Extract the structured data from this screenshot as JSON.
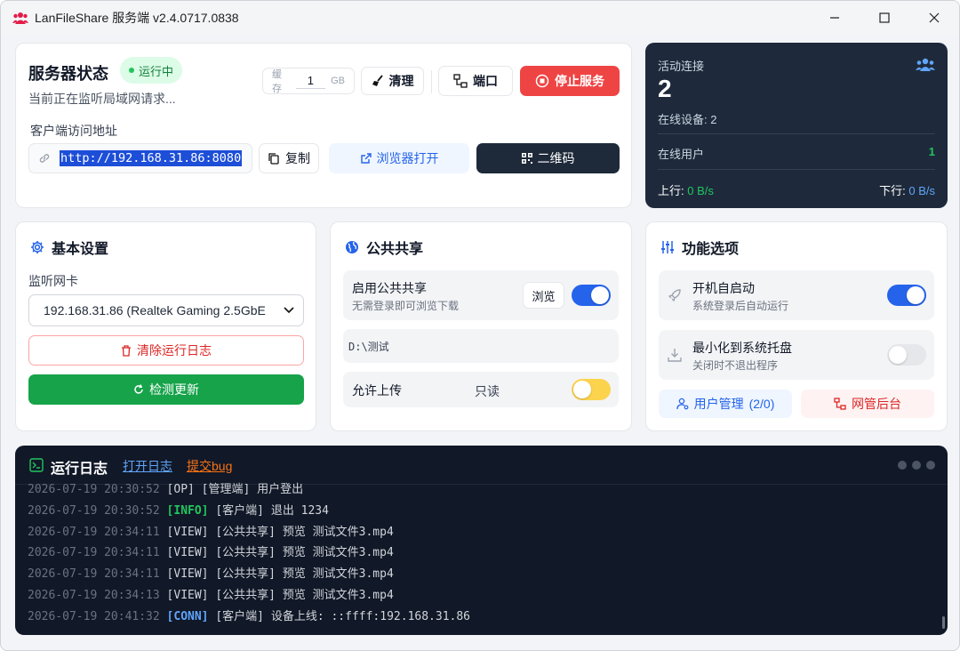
{
  "window": {
    "title": "LanFileShare 服务端 v2.4.0717.0838"
  },
  "server": {
    "title": "服务器状态",
    "status": "运行中",
    "subtitle": "当前正在监听局域网请求...",
    "cache_label": "缓存",
    "cache_value": "1",
    "cache_unit": "GB",
    "clear_label": "清理",
    "port_label": "端口",
    "stop_label": "停止服务",
    "client_address_label": "客户端访问地址",
    "url": "http://192.168.31.86:8080",
    "copy_label": "复制",
    "open_browser_label": "浏览器打开",
    "qrcode_label": "二维码"
  },
  "stats": {
    "active_label": "活动连接",
    "active_count": "2",
    "online_devices": "在线设备: 2",
    "online_users_label": "在线用户",
    "online_users_count": "1",
    "upload_label": "上行:",
    "upload_value": "0 B/s",
    "download_label": "下行:",
    "download_value": "0 B/s"
  },
  "basic": {
    "title": "基本设置",
    "nic_label": "监听网卡",
    "nic_value": "192.168.31.86 (Realtek Gaming 2.5GbE",
    "clear_log_label": "清除运行日志",
    "check_update_label": "检测更新"
  },
  "public": {
    "title": "公共共享",
    "enable_title": "启用公共共享",
    "enable_sub": "无需登录即可浏览下载",
    "browse_label": "浏览",
    "enabled": true,
    "path": "D:\\测试",
    "upload_label": "允许上传",
    "upload_mode": "只读",
    "upload_enabled": false
  },
  "features": {
    "title": "功能选项",
    "autostart_title": "开机自启动",
    "autostart_sub": "系统登录后自动运行",
    "autostart_enabled": true,
    "tray_title": "最小化到系统托盘",
    "tray_sub": "关闭时不退出程序",
    "tray_enabled": false,
    "user_mgmt_label": "用户管理",
    "user_mgmt_count": "(2/0)",
    "admin_label": "网管后台"
  },
  "log": {
    "title": "运行日志",
    "open_log_label": "打开日志",
    "submit_bug_label": "提交bug",
    "lines": [
      {
        "ts": "2026-07-19 20:30:52",
        "tag": "[OP]",
        "type": "op",
        "msg": "[管理端] 用户登出"
      },
      {
        "ts": "2026-07-19 20:30:52",
        "tag": "[INFO]",
        "type": "info",
        "msg": "[客户端] 退出 1234"
      },
      {
        "ts": "2026-07-19 20:34:11",
        "tag": "[VIEW]",
        "type": "view",
        "msg": "[公共共享] 预览 测试文件3.mp4"
      },
      {
        "ts": "2026-07-19 20:34:11",
        "tag": "[VIEW]",
        "type": "view",
        "msg": "[公共共享] 预览 测试文件3.mp4"
      },
      {
        "ts": "2026-07-19 20:34:11",
        "tag": "[VIEW]",
        "type": "view",
        "msg": "[公共共享] 预览 测试文件3.mp4"
      },
      {
        "ts": "2026-07-19 20:34:13",
        "tag": "[VIEW]",
        "type": "view",
        "msg": "[公共共享] 预览 测试文件3.mp4"
      },
      {
        "ts": "2026-07-19 20:41:32",
        "tag": "[CONN]",
        "type": "conn",
        "msg": "[客户端] 设备上线: ::ffff:192.168.31.86"
      }
    ]
  },
  "colors": {
    "accent": "#2563eb",
    "danger": "#ef4444",
    "success": "#16a34a",
    "dark_panel": "#1e2a3b",
    "log_bg": "#111827"
  }
}
